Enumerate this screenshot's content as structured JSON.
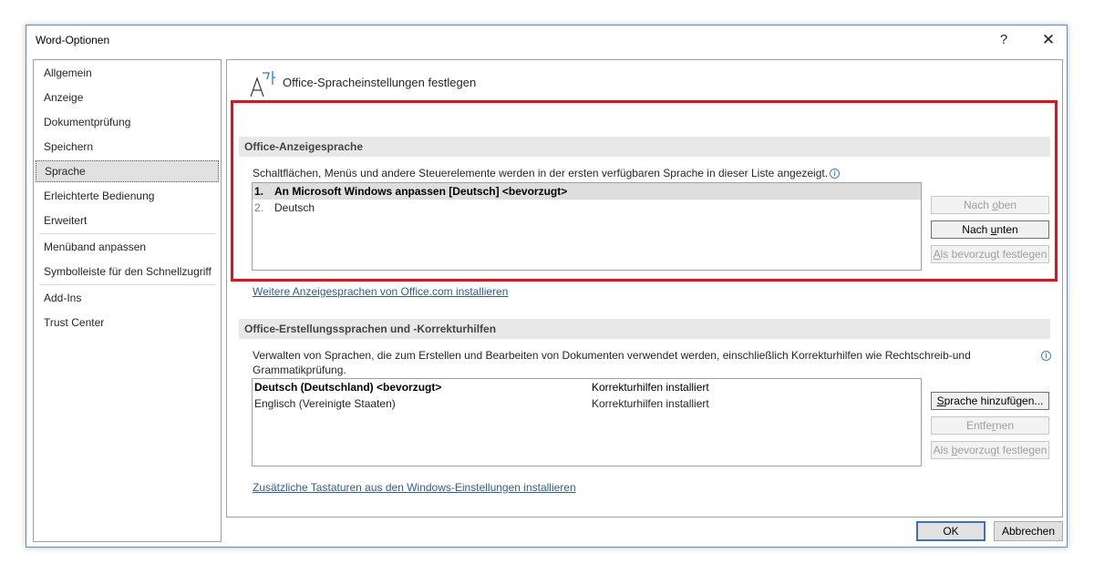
{
  "window": {
    "title": "Word-Optionen",
    "help_label": "?",
    "close_label": "✕"
  },
  "sidebar": {
    "items": [
      {
        "label": "Allgemein"
      },
      {
        "label": "Anzeige"
      },
      {
        "label": "Dokumentprüfung"
      },
      {
        "label": "Speichern"
      },
      {
        "label": "Sprache",
        "selected": true
      },
      {
        "label": "Erleichterte Bedienung"
      },
      {
        "label": "Erweitert"
      },
      {
        "label": "Menüband anpassen"
      },
      {
        "label": "Symbolleiste für den Schnellzugriff"
      },
      {
        "label": "Add-Ins"
      },
      {
        "label": "Trust Center"
      }
    ]
  },
  "header": {
    "icon": "language-icon",
    "title": "Office-Spracheinstellungen festlegen"
  },
  "display_language": {
    "heading": "Office-Anzeigesprache",
    "description": "Schaltflächen, Menüs und andere Steuerelemente werden in der ersten verfügbaren Sprache in dieser Liste angezeigt.",
    "items": [
      {
        "num": "1.",
        "label": "An Microsoft Windows anpassen [Deutsch] <bevorzugt>",
        "selected": true
      },
      {
        "num": "2.",
        "label": "Deutsch"
      }
    ],
    "buttons": {
      "up": {
        "pre": "Nach ",
        "key": "o",
        "post": "ben"
      },
      "down": {
        "pre": "Nach ",
        "key": "u",
        "post": "nten"
      },
      "preferred": {
        "pre": "",
        "key": "A",
        "post": "ls bevorzugt festlegen"
      }
    },
    "link": "Weitere Anzeigesprachen von Office.com installieren"
  },
  "authoring_language": {
    "heading": "Office-Erstellungssprachen und -Korrekturhilfen",
    "description_line1": "Verwalten von Sprachen, die zum Erstellen und Bearbeiten von Dokumenten verwendet werden, einschließlich Korrekturhilfen wie Rechtschreib-und",
    "description_line2": "Grammatikprüfung.",
    "items": [
      {
        "language": "Deutsch (Deutschland) <bevorzugt>",
        "status": "Korrekturhilfen installiert",
        "bold": true
      },
      {
        "language": "Englisch (Vereinigte Staaten)",
        "status": "Korrekturhilfen installiert"
      }
    ],
    "buttons": {
      "add": {
        "pre": "",
        "key": "S",
        "post": "prache hinzufügen..."
      },
      "remove": {
        "pre": "Entfe",
        "key": "r",
        "post": "nen"
      },
      "preferred": {
        "pre": "Als ",
        "key": "b",
        "post": "evorzugt festlegen"
      }
    },
    "link": "Zusätzliche Tastaturen aus den Windows-Einstellungen installieren"
  },
  "footer": {
    "ok": "OK",
    "cancel": "Abbrechen"
  },
  "colors": {
    "highlight_border": "#e3101d",
    "link": "#2e5d9a",
    "ok_border": "#3c73b4"
  }
}
